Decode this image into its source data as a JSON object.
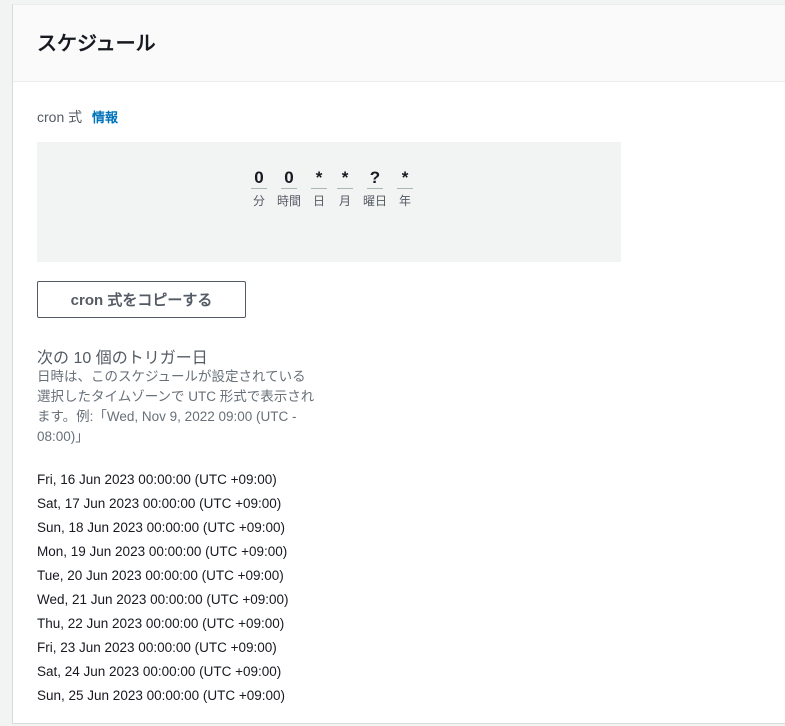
{
  "header": {
    "title": "スケジュール"
  },
  "cron": {
    "label": "cron 式",
    "info_link": "情報",
    "fields": [
      {
        "value": "0",
        "unit": "分"
      },
      {
        "value": "0",
        "unit": "時間"
      },
      {
        "value": "*",
        "unit": "日"
      },
      {
        "value": "*",
        "unit": "月"
      },
      {
        "value": "?",
        "unit": "曜日"
      },
      {
        "value": "*",
        "unit": "年"
      }
    ],
    "copy_button": "cron 式をコピーする"
  },
  "triggers": {
    "title": "次の 10 個のトリガー日",
    "description": "日時は、このスケジュールが設定されている選択したタイムゾーンで UTC 形式で表示されます。例:「Wed, Nov 9, 2022 09:00 (UTC - 08:00)」",
    "dates": [
      "Fri, 16 Jun 2023 00:00:00 (UTC +09:00)",
      "Sat, 17 Jun 2023 00:00:00 (UTC +09:00)",
      "Sun, 18 Jun 2023 00:00:00 (UTC +09:00)",
      "Mon, 19 Jun 2023 00:00:00 (UTC +09:00)",
      "Tue, 20 Jun 2023 00:00:00 (UTC +09:00)",
      "Wed, 21 Jun 2023 00:00:00 (UTC +09:00)",
      "Thu, 22 Jun 2023 00:00:00 (UTC +09:00)",
      "Fri, 23 Jun 2023 00:00:00 (UTC +09:00)",
      "Sat, 24 Jun 2023 00:00:00 (UTC +09:00)",
      "Sun, 25 Jun 2023 00:00:00 (UTC +09:00)"
    ]
  }
}
